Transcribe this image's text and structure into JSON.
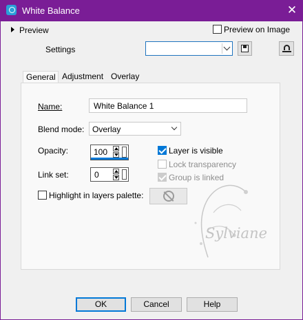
{
  "window": {
    "title": "White Balance"
  },
  "top": {
    "preview_label": "Preview",
    "preview_on_image_label": "Preview on Image",
    "settings_label": "Settings",
    "settings_value": ""
  },
  "tabs": [
    {
      "label": "General"
    },
    {
      "label": "Adjustment"
    },
    {
      "label": "Overlay"
    }
  ],
  "general": {
    "name_label": "Name:",
    "name_value": "White Balance 1",
    "blend_mode_label": "Blend mode:",
    "blend_mode_value": "Overlay",
    "opacity_label": "Opacity:",
    "opacity_value": "100",
    "link_set_label": "Link set:",
    "link_set_value": "0",
    "highlight_label": "Highlight in layers palette:",
    "layer_visible_label": "Layer is visible",
    "lock_transparency_label": "Lock transparency",
    "group_linked_label": "Group is linked"
  },
  "watermark": {
    "text": "Sylviane"
  },
  "buttons": {
    "ok": "OK",
    "cancel": "Cancel",
    "help": "Help"
  },
  "colors": {
    "titlebar": "#7a1d96",
    "accent": "#0078d7"
  }
}
